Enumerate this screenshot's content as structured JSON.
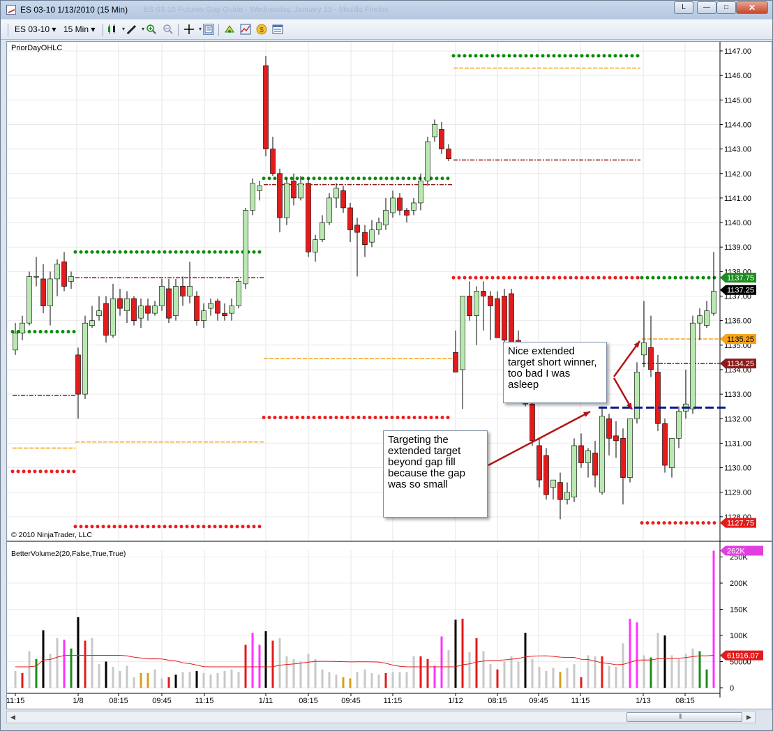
{
  "window": {
    "title": "ES 03-10  1/13/2010 (15 Min)",
    "ghost_title": "ES 03-10 Futures Gap Guide - Wednesday, January 13 - Mozilla Firefox",
    "btn_l": "L",
    "btn_min": "—",
    "btn_max": "□",
    "btn_close": "✕"
  },
  "toolbar": {
    "instrument": "ES 03-10",
    "interval": "15 Min",
    "dropdown_arrow": "▾",
    "icons": [
      "candlestick-icon",
      "pencil-draw-icon",
      "zoom-in-icon",
      "zoom-out-icon",
      "crosshair-icon",
      "data-box-icon",
      "strategy-icon",
      "indicators-icon",
      "money-icon",
      "properties-icon"
    ]
  },
  "chart": {
    "price_panel_label": "PriorDayOHLC",
    "copyright": "© 2010 NinjaTrader, LLC",
    "volume_panel_label": "BetterVolume2(20,False,True,True)",
    "price_axis_ticks": [
      "1147.00",
      "1146.00",
      "1145.00",
      "1144.00",
      "1143.00",
      "1142.00",
      "1141.00",
      "1140.00",
      "1139.00",
      "1138.00",
      "1137.00",
      "1136.00",
      "1135.00",
      "1134.00",
      "1133.00",
      "1132.00",
      "1131.00",
      "1130.00",
      "1129.00",
      "1128.00"
    ],
    "price_markers": [
      {
        "label": "1137.75",
        "color": "#1e8c1e"
      },
      {
        "label": "1137.25",
        "color": "#000000"
      },
      {
        "label": "1135.25",
        "color": "#f5a31a"
      },
      {
        "label": "1134.25",
        "color": "#8c1c1c"
      },
      {
        "label": "1127.75",
        "color": "#e31b1b"
      }
    ],
    "volume_axis_ticks": [
      "250K",
      "200K",
      "150K",
      "100K",
      "50000",
      "0"
    ],
    "volume_markers": [
      {
        "label": "262K",
        "color": "#e040e0"
      },
      {
        "label": "61916.07",
        "color": "#e31b1b"
      }
    ],
    "time_axis_labels": [
      "11:15",
      "1/8",
      "08:15",
      "09:45",
      "11:15",
      "1/11",
      "08:15",
      "09:45",
      "11:15",
      "1/12",
      "08:15",
      "09:45",
      "11:15",
      "1/13",
      "08:15"
    ],
    "colors": {
      "up": "#b9e8b0",
      "down": "#e31b1b",
      "high": "#0a8c0a",
      "low": "#ee1c1c",
      "open": "#f5a31a",
      "close": "#8c1c1c",
      "target": "#0d1a8c",
      "vol_grey": "#c8c8c8",
      "vol_magenta": "#ff33ff",
      "vol_red": "#e31b1b",
      "vol_green": "#1a8c1a",
      "vol_black": "#000000",
      "vol_gold": "#d4a017",
      "vol_ma": "#e31b1b"
    }
  },
  "annotations": {
    "callout_1": "Nice extended target short winner, too bad I was asleep",
    "callout_2": "Targeting the extended target beyond gap fill because the gap was so small"
  }
}
